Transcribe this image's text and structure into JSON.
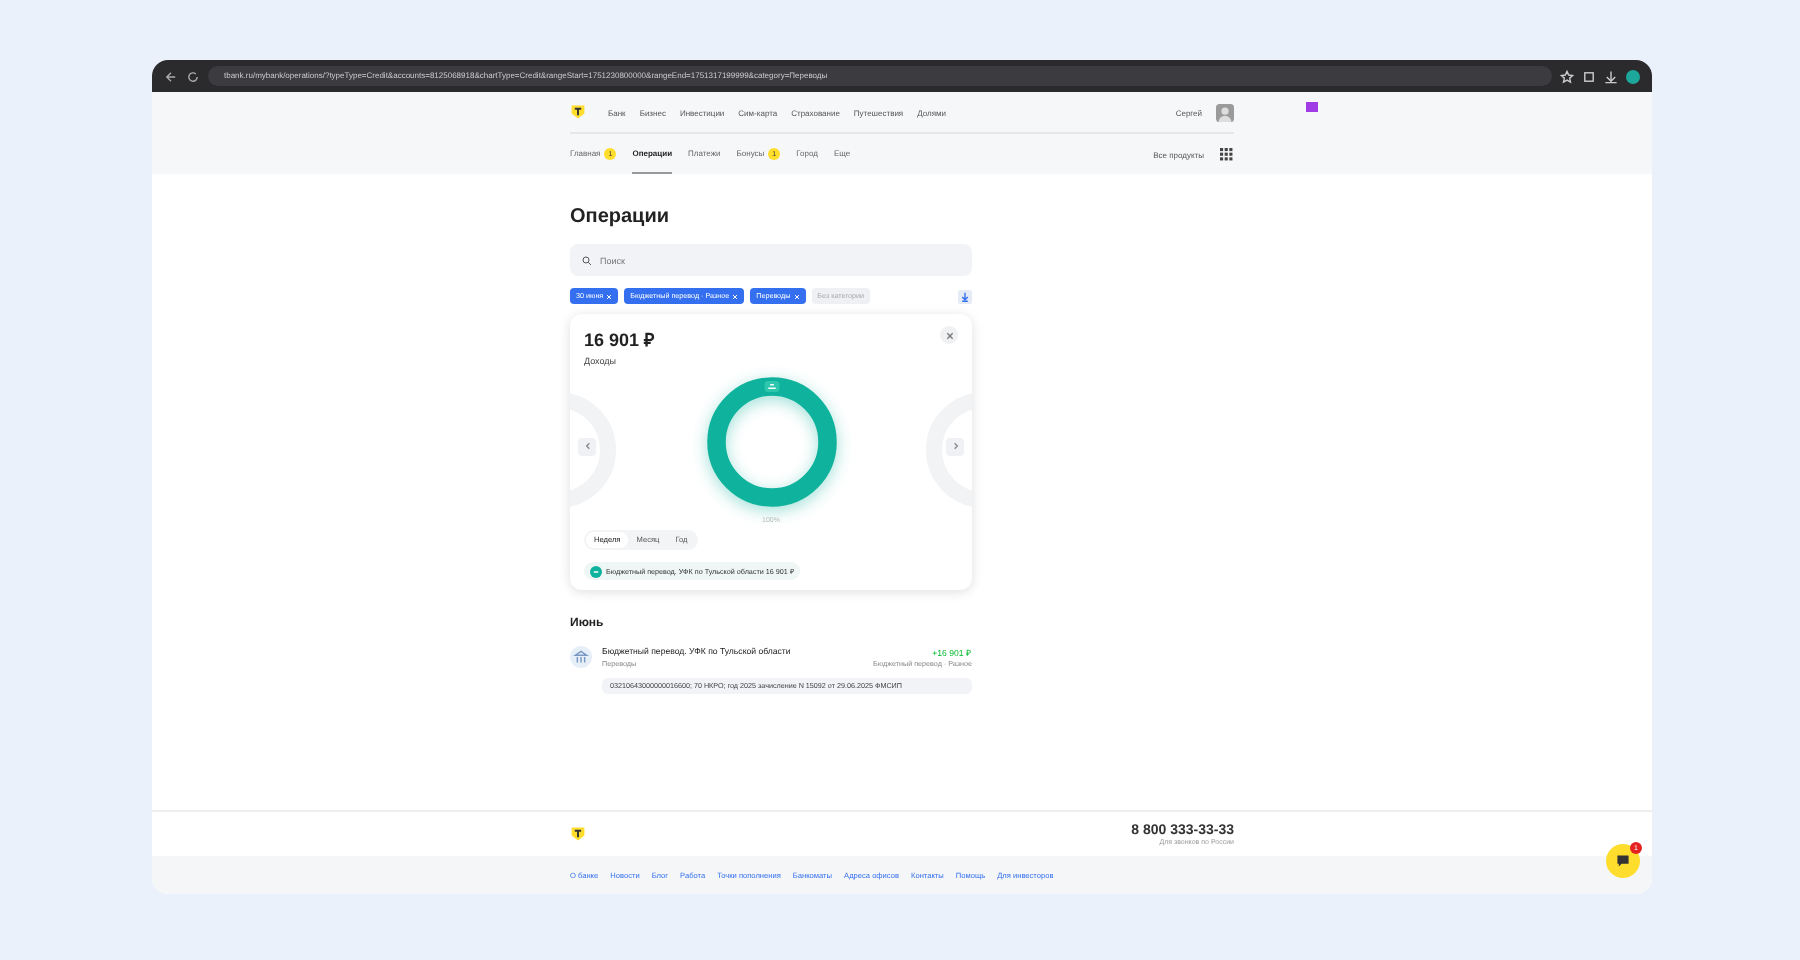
{
  "browser": {
    "url": "tbank.ru/mybank/operations/?typeType=Credit&accounts=8125068918&chartType=Credit&rangeStart=1751230800000&rangeEnd=1751317199999&category=Переводы"
  },
  "header": {
    "nav": [
      "Банк",
      "Бизнес",
      "Инвестиции",
      "Сим-карта",
      "Страхование",
      "Путешествия",
      "Долями"
    ],
    "user": "Сергей",
    "tabs": [
      {
        "label": "Главная",
        "badge": "1",
        "selected": false
      },
      {
        "label": "Операции",
        "selected": true
      },
      {
        "label": "Платежи",
        "selected": false
      },
      {
        "label": "Бонусы",
        "badge": "1",
        "selected": false
      },
      {
        "label": "Город",
        "selected": false
      },
      {
        "label": "Еще",
        "selected": false
      }
    ],
    "all_products": "Все продукты"
  },
  "title": "Операции",
  "search": {
    "placeholder": "Поиск"
  },
  "filters": [
    {
      "label": "30 июня",
      "kind": "active"
    },
    {
      "label": "Бюджетный перевод · Разное",
      "kind": "active"
    },
    {
      "label": "Переводы",
      "kind": "active"
    },
    {
      "label": "Без категории",
      "kind": "faded"
    }
  ],
  "summary": {
    "amount": "16 901 ₽",
    "label": "Доходы",
    "share": "100%",
    "periods": [
      {
        "label": "Неделя",
        "selected": true
      },
      {
        "label": "Месяц",
        "selected": false
      },
      {
        "label": "Год",
        "selected": false
      }
    ],
    "legend": "Бюджетный перевод. УФК по Тульской области 16 901 ₽"
  },
  "month": "Июнь",
  "transactions": [
    {
      "title": "Бюджетный перевод. УФК по Тульской области",
      "category": "Переводы",
      "amount": "+16 901 ₽",
      "account": "Бюджетный перевод · Разное",
      "description": "03210643000000016600; 70 НКРО; год 2025 зачисление N 15092 от 29.06.2025 ФМСИП"
    }
  ],
  "footer": {
    "phone": "8 800 333-33-33",
    "phone_note": "Для звонков по России",
    "links": [
      "О банке",
      "Новости",
      "Блог",
      "Работа",
      "Точки пополнения",
      "Банкоматы",
      "Адреса офисов",
      "Контакты",
      "Помощь",
      "Для инвесторов"
    ],
    "chat_badge": "1"
  }
}
